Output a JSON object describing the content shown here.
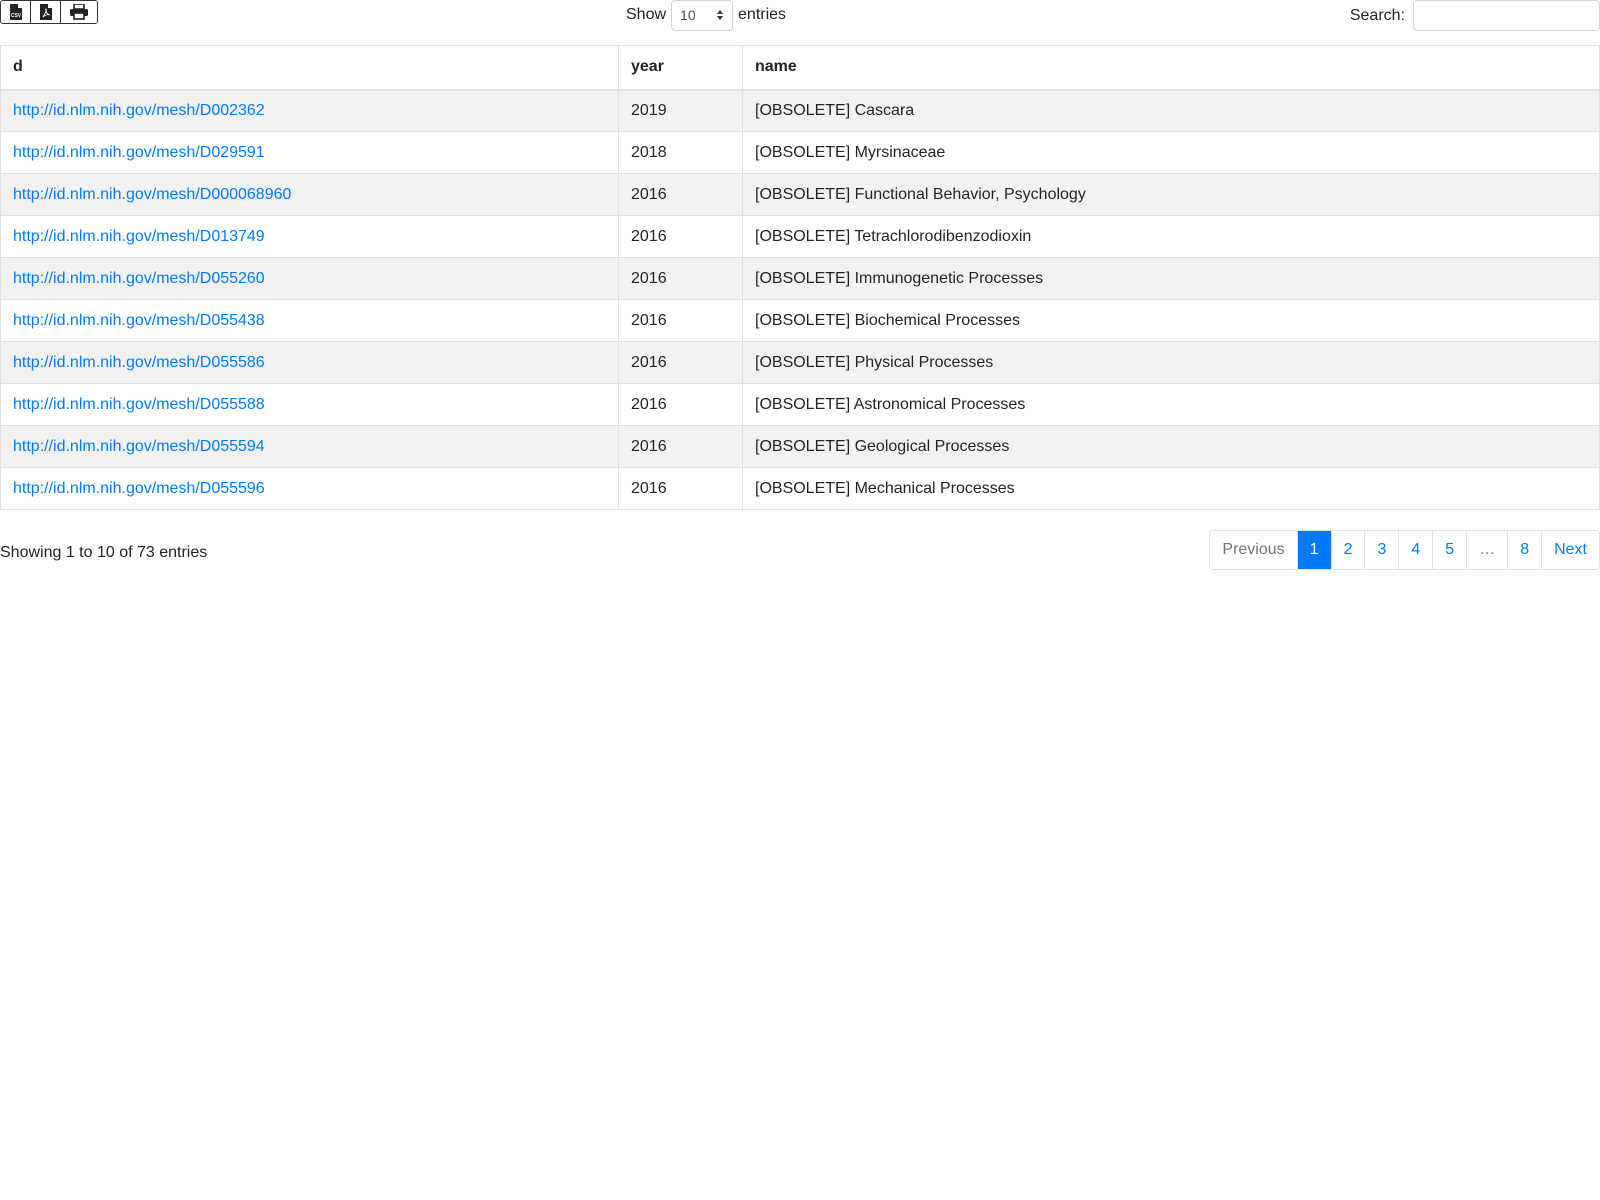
{
  "toolbar": {
    "buttons": [
      {
        "icon": "csv-file-icon"
      },
      {
        "icon": "pdf-file-icon"
      },
      {
        "icon": "print-icon"
      }
    ]
  },
  "length": {
    "show_label": "Show",
    "selected": "10",
    "entries_label": "entries"
  },
  "search": {
    "label": "Search:",
    "value": "",
    "placeholder": ""
  },
  "table": {
    "headers": [
      "d",
      "year",
      "name"
    ],
    "rows": [
      {
        "d": "http://id.nlm.nih.gov/mesh/D002362",
        "year": "2019",
        "name": "[OBSOLETE] Cascara"
      },
      {
        "d": "http://id.nlm.nih.gov/mesh/D029591",
        "year": "2018",
        "name": "[OBSOLETE] Myrsinaceae"
      },
      {
        "d": "http://id.nlm.nih.gov/mesh/D000068960",
        "year": "2016",
        "name": "[OBSOLETE] Functional Behavior, Psychology"
      },
      {
        "d": "http://id.nlm.nih.gov/mesh/D013749",
        "year": "2016",
        "name": "[OBSOLETE] Tetrachlorodibenzodioxin"
      },
      {
        "d": "http://id.nlm.nih.gov/mesh/D055260",
        "year": "2016",
        "name": "[OBSOLETE] Immunogenetic Processes"
      },
      {
        "d": "http://id.nlm.nih.gov/mesh/D055438",
        "year": "2016",
        "name": "[OBSOLETE] Biochemical Processes"
      },
      {
        "d": "http://id.nlm.nih.gov/mesh/D055586",
        "year": "2016",
        "name": "[OBSOLETE] Physical Processes"
      },
      {
        "d": "http://id.nlm.nih.gov/mesh/D055588",
        "year": "2016",
        "name": "[OBSOLETE] Astronomical Processes"
      },
      {
        "d": "http://id.nlm.nih.gov/mesh/D055594",
        "year": "2016",
        "name": "[OBSOLETE] Geological Processes"
      },
      {
        "d": "http://id.nlm.nih.gov/mesh/D055596",
        "year": "2016",
        "name": "[OBSOLETE] Mechanical Processes"
      }
    ]
  },
  "info": "Showing 1 to 10 of 73 entries",
  "pagination": {
    "items": [
      {
        "label": "Previous",
        "state": "disabled"
      },
      {
        "label": "1",
        "state": "active"
      },
      {
        "label": "2",
        "state": ""
      },
      {
        "label": "3",
        "state": ""
      },
      {
        "label": "4",
        "state": ""
      },
      {
        "label": "5",
        "state": ""
      },
      {
        "label": "…",
        "state": "disabled"
      },
      {
        "label": "8",
        "state": ""
      },
      {
        "label": "Next",
        "state": ""
      }
    ]
  },
  "colors": {
    "link": "#007bff",
    "active_page": "#007bff",
    "stripe": "#f2f2f2"
  }
}
